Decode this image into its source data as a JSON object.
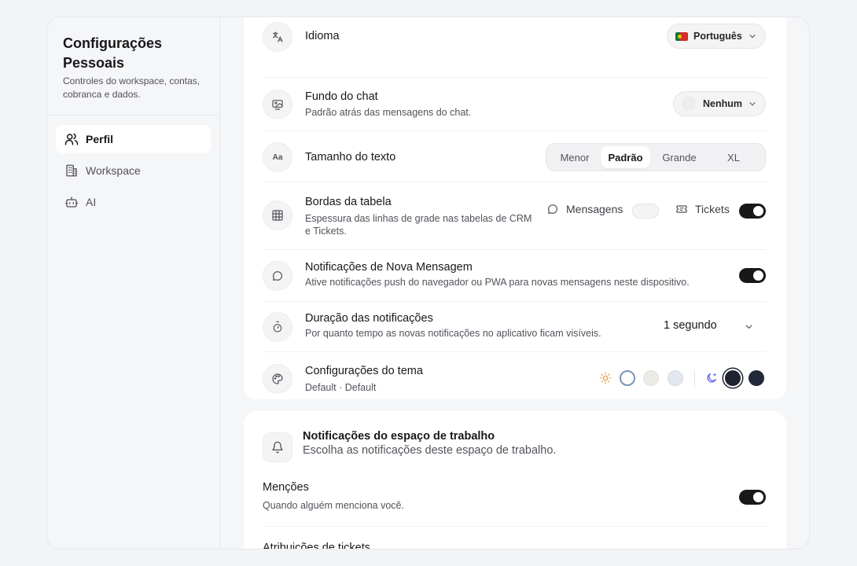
{
  "sidebar": {
    "title": "Configurações Pessoais",
    "description": "Controles do workspace, contas, cobranca e dados.",
    "items": [
      {
        "label": "Perfil",
        "icon": "users-icon",
        "active": true
      },
      {
        "label": "Workspace",
        "icon": "building-icon",
        "active": false
      },
      {
        "label": "AI",
        "icon": "bot-icon",
        "active": false
      }
    ]
  },
  "preferences": {
    "language": {
      "title": "Idioma",
      "value": "Português"
    },
    "chat_background": {
      "title": "Fundo do chat",
      "description": "Padrão atrás das mensagens do chat.",
      "value": "Nenhum"
    },
    "text_size": {
      "title": "Tamanho do texto",
      "options": [
        "Menor",
        "Padrão",
        "Grande",
        "XL"
      ],
      "selected": "Padrão"
    },
    "table_borders": {
      "title": "Bordas da tabela",
      "description": "Espessura das linhas de grade nas tabelas de CRM e Tickets.",
      "messages_label": "Mensagens",
      "messages_enabled": false,
      "tickets_label": "Tickets",
      "tickets_enabled": true
    },
    "new_message_notifications": {
      "title": "Notificações de Nova Mensagem",
      "description": "Ative notificações push do navegador ou PWA para novas mensagens neste dispositivo.",
      "enabled": true
    },
    "notification_duration": {
      "title": "Duração das notificações",
      "description": "Por quanto tempo as novas notificações no aplicativo ficam visíveis.",
      "value": "1 segundo"
    },
    "theme": {
      "title": "Configurações do tema",
      "subtitle": "Default · Default",
      "light_swatches": [
        "#ffffff",
        "#ecebe6",
        "#e3e7ee"
      ],
      "dark_swatches": [
        "#1f2330",
        "#1f2937"
      ],
      "sun_color": "#e6a23c",
      "moon_color": "#6366f1"
    }
  },
  "workspace_notifications": {
    "title": "Notificações do espaço de trabalho",
    "description": "Escolha as notificações deste espaço de trabalho.",
    "mentions": {
      "title": "Menções",
      "description": "Quando alguém menciona você.",
      "enabled": true
    },
    "ticket_assignments": {
      "title": "Atribuições de tickets"
    }
  }
}
